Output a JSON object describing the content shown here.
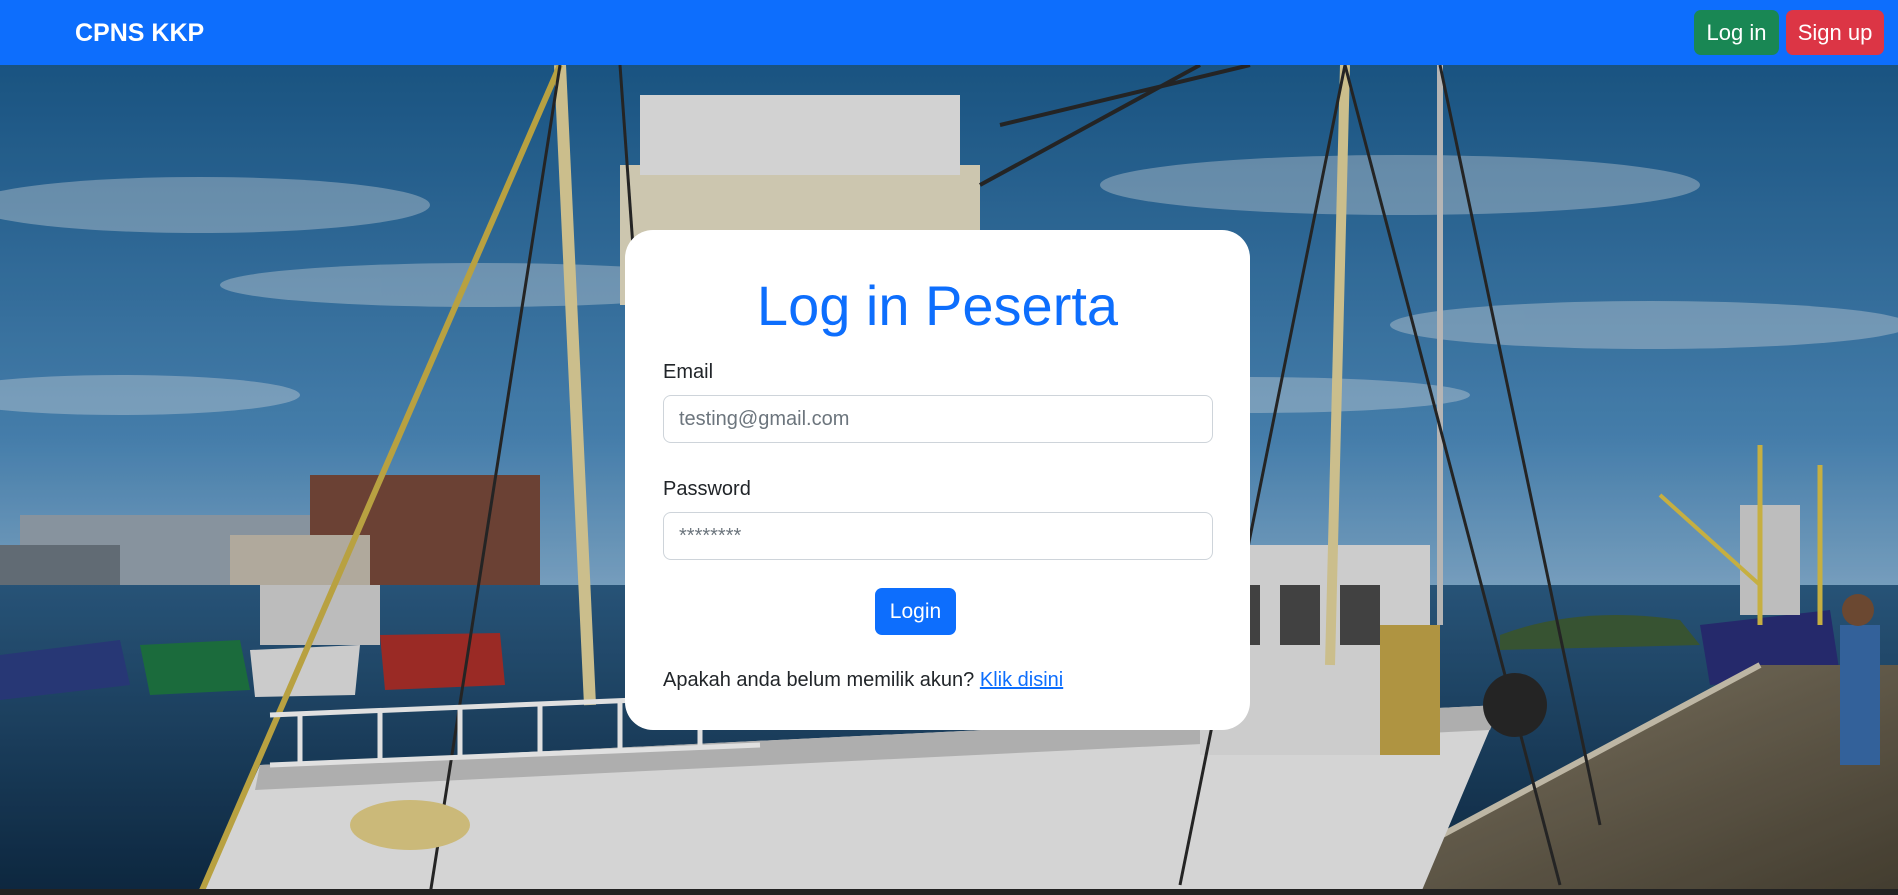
{
  "navbar": {
    "brand": "CPNS KKP",
    "login_label": "Log in",
    "signup_label": "Sign up",
    "color": "#0d6efd"
  },
  "background": {
    "icon": "harbor-fishing-boats-photo"
  },
  "login_card": {
    "title": "Log in Peserta",
    "email": {
      "label": "Email",
      "placeholder": "testing@gmail.com",
      "value": ""
    },
    "password": {
      "label": "Password",
      "placeholder": "********",
      "value": ""
    },
    "submit_label": "Login",
    "signup_prompt": "Apakah anda belum memilik akun?",
    "signup_link": "Klik disini"
  },
  "colors": {
    "primary": "#0d6efd",
    "success": "#198754",
    "danger": "#dc3545"
  }
}
